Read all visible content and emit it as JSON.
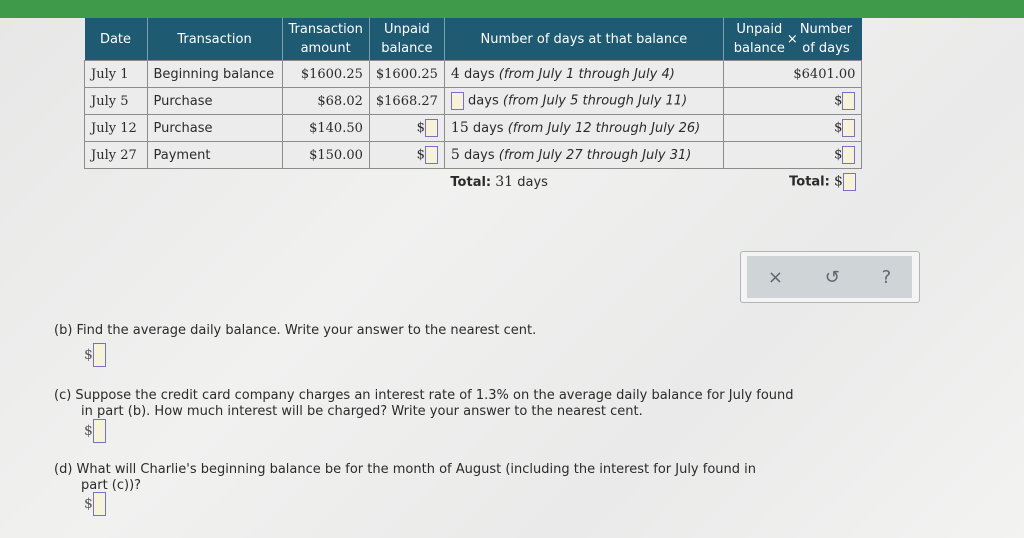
{
  "table": {
    "headers": {
      "date": "Date",
      "transaction": "Transaction",
      "amount_line1": "Transaction",
      "amount_line2": "amount",
      "unpaid_line1": "Unpaid",
      "unpaid_line2": "balance",
      "days": "Number of days at that balance",
      "product_left1": "Unpaid",
      "product_left2": "balance",
      "product_times": "×",
      "product_right1": "Number",
      "product_right2": "of days"
    },
    "rows": [
      {
        "date": "July 1",
        "transaction": "Beginning balance",
        "amount": "$1600.25",
        "unpaid": "$1600.25",
        "days_count": "4",
        "days_text": "days",
        "days_range": "(from July 1 through July 4)",
        "product": "$6401.00"
      },
      {
        "date": "July 5",
        "transaction": "Purchase",
        "amount": "$68.02",
        "unpaid": "$1668.27",
        "days_count": "",
        "days_text": "days",
        "days_range": "(from July 5 through July 11)",
        "product": "$"
      },
      {
        "date": "July 12",
        "transaction": "Purchase",
        "amount": "$140.50",
        "unpaid": "$",
        "days_count": "15",
        "days_text": "days",
        "days_range": "(from July 12 through July 26)",
        "product": "$"
      },
      {
        "date": "July 27",
        "transaction": "Payment",
        "amount": "$150.00",
        "unpaid": "$",
        "days_count": "5",
        "days_text": "days",
        "days_range": "(from July 27 through July 31)",
        "product": "$"
      }
    ],
    "total_days_label": "Total:",
    "total_days_value": "31",
    "total_days_unit": "days",
    "total_product_label": "Total:",
    "total_product_prefix": "$"
  },
  "toolbox": {
    "clear_icon": "×",
    "undo_icon": "↺",
    "help_icon": "?"
  },
  "questions": {
    "b": "(b) Find the average daily balance. Write your answer to the nearest cent.",
    "c_line1": "(c) Suppose the credit card company charges an interest rate of 1.3% on the average daily balance for July found",
    "c_line2": "in part (b). How much interest will be charged? Write your answer to the nearest cent.",
    "d_line1": "(d) What will Charlie's beginning balance be for the month of August (including the interest for July found in",
    "d_line2": "part (c))?",
    "currency": "$"
  }
}
